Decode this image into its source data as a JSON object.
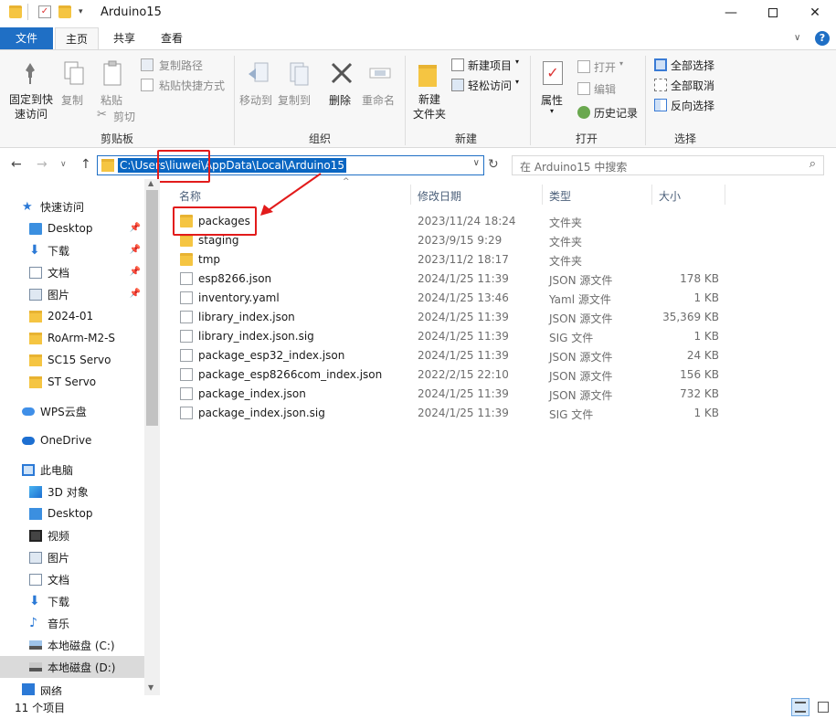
{
  "window": {
    "title": "Arduino15"
  },
  "tabs": [
    "文件",
    "主页",
    "共享",
    "查看"
  ],
  "ribbon": {
    "clipboard": {
      "pin": "固定到快\n速访问",
      "copy": "复制",
      "paste": "粘贴",
      "copy_path": "复制路径",
      "paste_shortcut": "粘贴快捷方式",
      "cut": "剪切",
      "group": "剪贴板"
    },
    "organize": {
      "move_to": "移动到",
      "copy_to": "复制到",
      "delete": "删除",
      "rename": "重命名",
      "group": "组织"
    },
    "new": {
      "new_folder": "新建\n文件夹",
      "new_item": "新建项目",
      "easy_access": "轻松访问",
      "group": "新建"
    },
    "open": {
      "properties": "属性",
      "open": "打开",
      "edit": "编辑",
      "history": "历史记录",
      "group": "打开"
    },
    "select": {
      "select_all": "全部选择",
      "select_none": "全部取消",
      "invert": "反向选择",
      "group": "选择"
    }
  },
  "address": {
    "path": "C:\\Users\\liuwei\\AppData\\Local\\Arduino15",
    "search_placeholder": "在 Arduino15 中搜索"
  },
  "nav": {
    "quick_access": "快速访问",
    "items": [
      {
        "label": "Desktop",
        "pinned": true,
        "icon": "desktop-icon"
      },
      {
        "label": "下载",
        "pinned": true,
        "icon": "download-icon"
      },
      {
        "label": "文档",
        "pinned": true,
        "icon": "document-icon"
      },
      {
        "label": "图片",
        "pinned": true,
        "icon": "picture-icon"
      },
      {
        "label": "2024-01",
        "pinned": false,
        "icon": "folder-icon"
      },
      {
        "label": "RoArm-M2-S",
        "pinned": false,
        "icon": "folder-icon"
      },
      {
        "label": "SC15 Servo",
        "pinned": false,
        "icon": "folder-icon"
      },
      {
        "label": "ST Servo",
        "pinned": false,
        "icon": "folder-icon"
      }
    ],
    "wps": "WPS云盘",
    "onedrive": "OneDrive",
    "this_pc": "此电脑",
    "pc_items": [
      {
        "label": "3D 对象",
        "icon": "3d-objects-icon"
      },
      {
        "label": "Desktop",
        "icon": "desktop-icon"
      },
      {
        "label": "视频",
        "icon": "video-icon"
      },
      {
        "label": "图片",
        "icon": "picture-icon"
      },
      {
        "label": "文档",
        "icon": "document-icon"
      },
      {
        "label": "下载",
        "icon": "download-icon"
      },
      {
        "label": "音乐",
        "icon": "music-icon"
      },
      {
        "label": "本地磁盘 (C:)",
        "icon": "drive-icon"
      },
      {
        "label": "本地磁盘 (D:)",
        "icon": "drive-icon"
      }
    ],
    "network": "网络"
  },
  "columns": {
    "name": "名称",
    "date": "修改日期",
    "type": "类型",
    "size": "大小"
  },
  "files": [
    {
      "name": "packages",
      "date": "2023/11/24 18:24",
      "type": "文件夹",
      "size": "",
      "kind": "folder"
    },
    {
      "name": "staging",
      "date": "2023/9/15 9:29",
      "type": "文件夹",
      "size": "",
      "kind": "folder"
    },
    {
      "name": "tmp",
      "date": "2023/11/2 18:17",
      "type": "文件夹",
      "size": "",
      "kind": "folder"
    },
    {
      "name": "esp8266.json",
      "date": "2024/1/25 11:39",
      "type": "JSON 源文件",
      "size": "178 KB",
      "kind": "file"
    },
    {
      "name": "inventory.yaml",
      "date": "2024/1/25 13:46",
      "type": "Yaml 源文件",
      "size": "1 KB",
      "kind": "file"
    },
    {
      "name": "library_index.json",
      "date": "2024/1/25 11:39",
      "type": "JSON 源文件",
      "size": "35,369 KB",
      "kind": "file"
    },
    {
      "name": "library_index.json.sig",
      "date": "2024/1/25 11:39",
      "type": "SIG 文件",
      "size": "1 KB",
      "kind": "file"
    },
    {
      "name": "package_esp32_index.json",
      "date": "2024/1/25 11:39",
      "type": "JSON 源文件",
      "size": "24 KB",
      "kind": "file"
    },
    {
      "name": "package_esp8266com_index.json",
      "date": "2022/2/15 22:10",
      "type": "JSON 源文件",
      "size": "156 KB",
      "kind": "file"
    },
    {
      "name": "package_index.json",
      "date": "2024/1/25 11:39",
      "type": "JSON 源文件",
      "size": "732 KB",
      "kind": "file"
    },
    {
      "name": "package_index.json.sig",
      "date": "2024/1/25 11:39",
      "type": "SIG 文件",
      "size": "1 KB",
      "kind": "file"
    }
  ],
  "status": {
    "count": "11 个项目"
  },
  "colors": {
    "accent": "#1f6fc5",
    "folder": "#f5c542",
    "annotation": "#e21b1b"
  }
}
